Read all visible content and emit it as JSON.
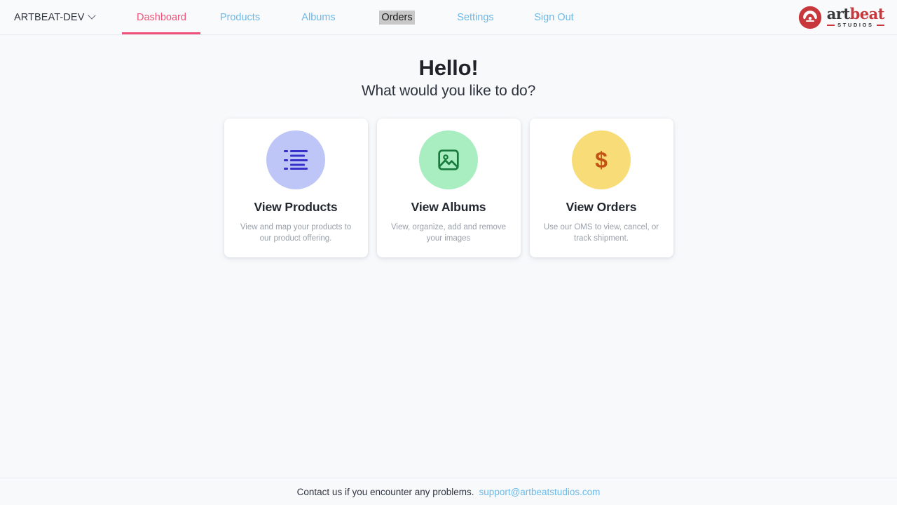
{
  "navbar": {
    "org": {
      "label": "ARTBEAT-DEV",
      "chevron_icon": "chevron-down-icon"
    },
    "links": [
      {
        "label": "Dashboard",
        "state": "active"
      },
      {
        "label": "Products",
        "state": "default"
      },
      {
        "label": "Albums",
        "state": "default"
      },
      {
        "label": "Orders",
        "state": "selected"
      },
      {
        "label": "Settings",
        "state": "default"
      },
      {
        "label": "Sign Out",
        "state": "default"
      }
    ],
    "logo": {
      "mark_icon": "artbeat-logo-icon",
      "word_first": "art",
      "word_second": "beat",
      "tagline": "STUDIOS"
    },
    "colors": {
      "active": "#ef5179",
      "link": "#6cb9e8",
      "selection_bg": "#c8c8c8",
      "brand_red": "#c7373b"
    }
  },
  "main": {
    "heading": "Hello!",
    "subheading": "What would you like to do?",
    "cards": [
      {
        "icon": "list-icon",
        "icon_bg": "#bdc6f7",
        "icon_color": "#3730c9",
        "title": "View Products",
        "description": "View and map your products to our product offering."
      },
      {
        "icon": "image-icon",
        "icon_bg": "#a8eec0",
        "icon_color": "#187a3c",
        "title": "View Albums",
        "description": "View, organize, add and remove your images"
      },
      {
        "icon": "dollar-sign-icon",
        "icon_bg": "#f8dc78",
        "icon_color": "#c25214",
        "title": "View Orders",
        "description": "Use our OMS to view, cancel, or track shipment."
      }
    ]
  },
  "footer": {
    "text": "Contact us if you encounter any problems.",
    "email": "support@artbeatstudios.com"
  }
}
